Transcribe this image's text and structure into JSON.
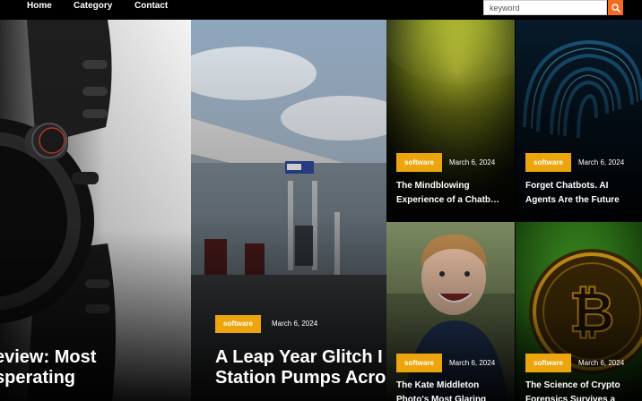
{
  "nav": {
    "home": "Home",
    "category": "Category",
    "contact": "Contact"
  },
  "search": {
    "placeholder": "keyword",
    "button_icon": "search-icon"
  },
  "colors": {
    "accent": "#f36b21",
    "badge": "#eca50c",
    "background": "#000000"
  },
  "cards": {
    "watch": {
      "title_line1": "eview: Most",
      "title_line2": "sperating"
    },
    "gas_station": {
      "category": "software",
      "date": "March 6, 2024",
      "title_line1": "A Leap Year Glitch I",
      "title_line2": "Station Pumps Acro"
    },
    "mindblowing": {
      "category": "software",
      "date": "March 6, 2024",
      "title_line1": "The Mindblowing",
      "title_line2": "Experience of a Chatb…"
    },
    "chatbots": {
      "category": "software",
      "date": "March 6, 2024",
      "title_line1": "Forget Chatbots. AI",
      "title_line2": "Agents Are the Future"
    },
    "kate": {
      "category": "software",
      "date": "March 6, 2024",
      "title_line1": "The Kate Middleton",
      "title_line2": "Photo's Most Glaring"
    },
    "crypto": {
      "category": "software",
      "date": "March 6, 2024",
      "title_line1": "The Science of Crypto",
      "title_line2": "Forensics Survives a"
    }
  }
}
